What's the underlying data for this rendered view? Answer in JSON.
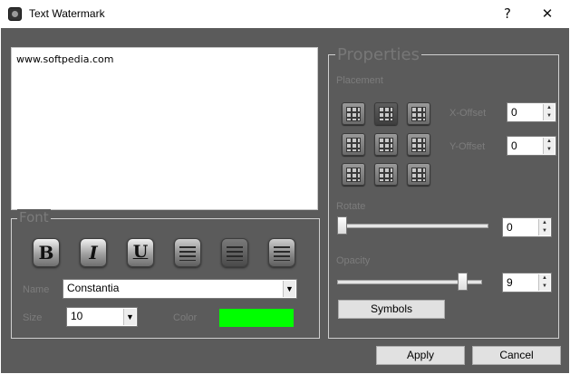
{
  "window": {
    "title": "Text Watermark",
    "help_label": "?",
    "close_label": "✕"
  },
  "editor": {
    "text": "www.softpedia.com"
  },
  "font": {
    "legend": "Font",
    "bold_label": "B",
    "italic_label": "I",
    "underline_label": "U",
    "name_label": "Name",
    "name_value": "Constantia",
    "size_label": "Size",
    "size_value": "10",
    "color_label": "Color",
    "color_value": "#00ff00"
  },
  "properties": {
    "legend": "Properties",
    "placement_label": "Placement",
    "x_offset_label": "X-Offset",
    "x_offset_value": "0",
    "y_offset_label": "Y-Offset",
    "y_offset_value": "0",
    "rotate_label": "Rotate",
    "rotate_value": "0",
    "opacity_label": "Opacity",
    "opacity_value": "9",
    "symbols_label": "Symbols"
  },
  "footer": {
    "apply_label": "Apply",
    "cancel_label": "Cancel"
  },
  "icons": {
    "dropdown": "▼",
    "spin_up": "▲",
    "spin_down": "▼"
  }
}
